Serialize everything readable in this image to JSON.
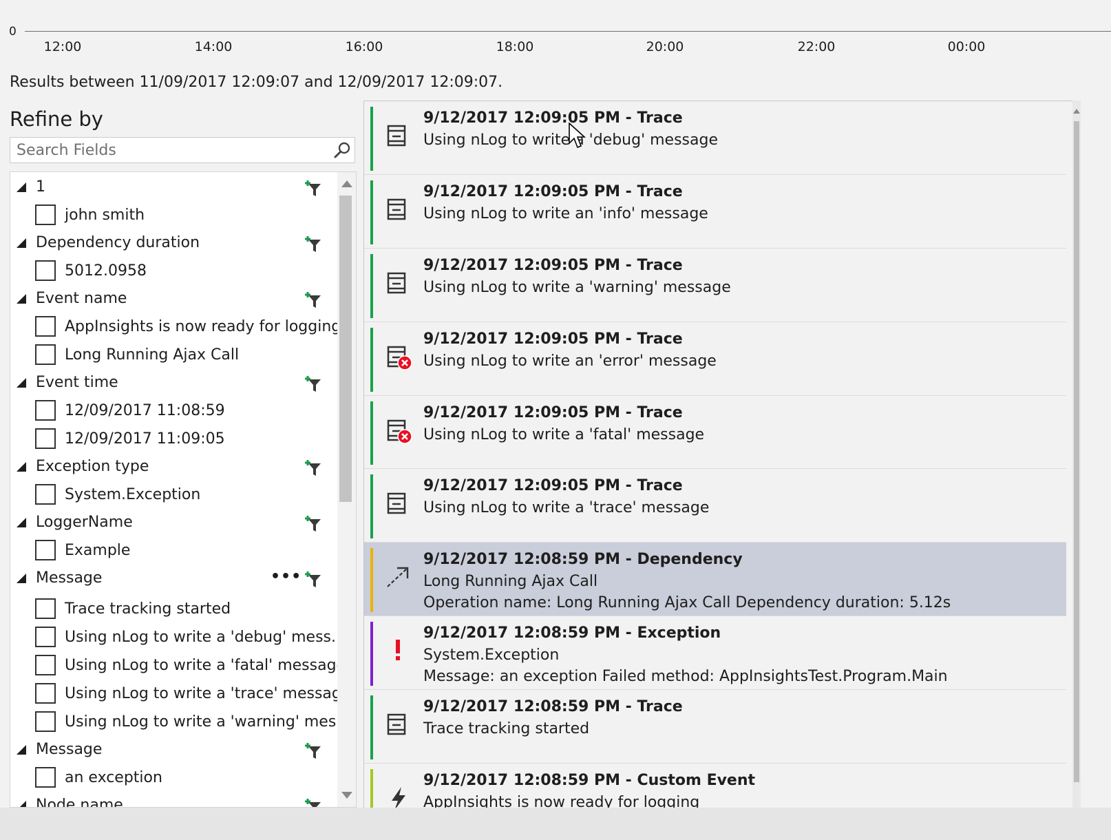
{
  "timeline": {
    "zero_label": "0",
    "ticks": [
      "12:00",
      "14:00",
      "16:00",
      "18:00",
      "20:00",
      "22:00",
      "00:00"
    ]
  },
  "results_summary": "Results between 11/09/2017 12:09:07 and 12/09/2017 12:09:07.",
  "refine": {
    "title": "Refine by",
    "search_placeholder": "Search Fields",
    "groups": [
      {
        "name": "1",
        "options": [
          "john smith"
        ]
      },
      {
        "name": "Dependency duration",
        "options": [
          "5012.0958"
        ]
      },
      {
        "name": "Event name",
        "options": [
          "AppInsights is now ready for logging",
          "Long Running Ajax Call"
        ]
      },
      {
        "name": "Event time",
        "options": [
          "12/09/2017 11:08:59",
          "12/09/2017 11:09:05"
        ]
      },
      {
        "name": "Exception type",
        "options": [
          "System.Exception"
        ]
      },
      {
        "name": "LoggerName",
        "options": [
          "Example"
        ]
      },
      {
        "name": "Message",
        "more": "•••",
        "options": [
          "Trace tracking started",
          "Using nLog to write a 'debug' mess...",
          "Using nLog to write a 'fatal' message",
          "Using nLog to write a 'trace' message",
          "Using nLog to write a 'warning' mes..."
        ]
      },
      {
        "name": "Message",
        "options": [
          "an exception"
        ]
      },
      {
        "name": "Node name",
        "options": []
      }
    ]
  },
  "results": [
    {
      "title": "9/12/2017 12:09:05 PM - Trace",
      "lines": [
        "Using nLog to write a 'debug' message"
      ],
      "icon": "trace-icon",
      "bar_color": "#16a34a"
    },
    {
      "title": "9/12/2017 12:09:05 PM - Trace",
      "lines": [
        "Using nLog to write an 'info' message"
      ],
      "icon": "trace-icon",
      "bar_color": "#16a34a"
    },
    {
      "title": "9/12/2017 12:09:05 PM - Trace",
      "lines": [
        "Using nLog to write a 'warning' message"
      ],
      "icon": "trace-icon",
      "bar_color": "#16a34a"
    },
    {
      "title": "9/12/2017 12:09:05 PM - Trace",
      "lines": [
        "Using nLog to write an 'error' message"
      ],
      "icon": "trace-error-icon",
      "bar_color": "#16a34a"
    },
    {
      "title": "9/12/2017 12:09:05 PM - Trace",
      "lines": [
        "Using nLog to write a 'fatal' message"
      ],
      "icon": "trace-error-icon",
      "bar_color": "#16a34a"
    },
    {
      "title": "9/12/2017 12:09:05 PM - Trace",
      "lines": [
        "Using nLog to write a 'trace' message"
      ],
      "icon": "trace-icon",
      "bar_color": "#16a34a"
    },
    {
      "title": "9/12/2017 12:08:59 PM - Dependency",
      "lines": [
        "Long Running Ajax Call",
        "Operation name: Long Running Ajax Call  Dependency duration: 5.12s"
      ],
      "icon": "dependency-arrow-icon",
      "bar_color": "#eab308",
      "selected": true
    },
    {
      "title": "9/12/2017 12:08:59 PM - Exception",
      "lines": [
        "System.Exception",
        "Message: an exception  Failed method: AppInsightsTest.Program.Main"
      ],
      "icon": "exception-icon",
      "bar_color": "#7e22ce"
    },
    {
      "title": "9/12/2017 12:08:59 PM - Trace",
      "lines": [
        "Trace tracking started"
      ],
      "icon": "trace-icon",
      "bar_color": "#16a34a"
    },
    {
      "title": "9/12/2017 12:08:59 PM - Custom Event",
      "lines": [
        "AppInsights is now ready for logging"
      ],
      "icon": "lightning-icon",
      "bar_color": "#a3c920"
    }
  ],
  "colors": {
    "selected_row": "#cacdda",
    "filter_icon_green": "#1e9b4a",
    "error_red": "#e81123"
  }
}
